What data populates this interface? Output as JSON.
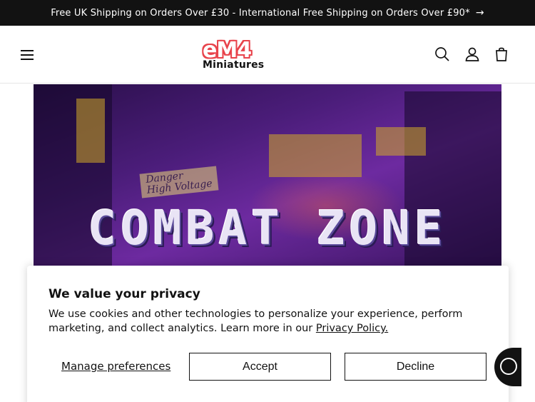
{
  "announcement": {
    "text": "Free UK Shipping on Orders Over £30 - International Free Shipping on Orders Over £90*",
    "arrow": "→"
  },
  "header": {
    "logo_top": "eM4",
    "logo_bottom": "Miniatures",
    "icons": [
      "menu-icon",
      "search-icon",
      "account-icon",
      "cart-icon"
    ]
  },
  "banner": {
    "title": "COMBAT ZONE",
    "sign_line1": "Danger",
    "sign_line2": "High Voltage"
  },
  "privacy": {
    "heading": "We value your privacy",
    "body": "We use cookies and other technologies to personalize your experience, perform marketing, and collect analytics. Learn more in our ",
    "link": "Privacy Policy.",
    "manage_label": "Manage preferences",
    "accept_label": "Accept",
    "decline_label": "Decline"
  },
  "colors": {
    "brand_red": "#e8434b",
    "dark": "#121212"
  }
}
